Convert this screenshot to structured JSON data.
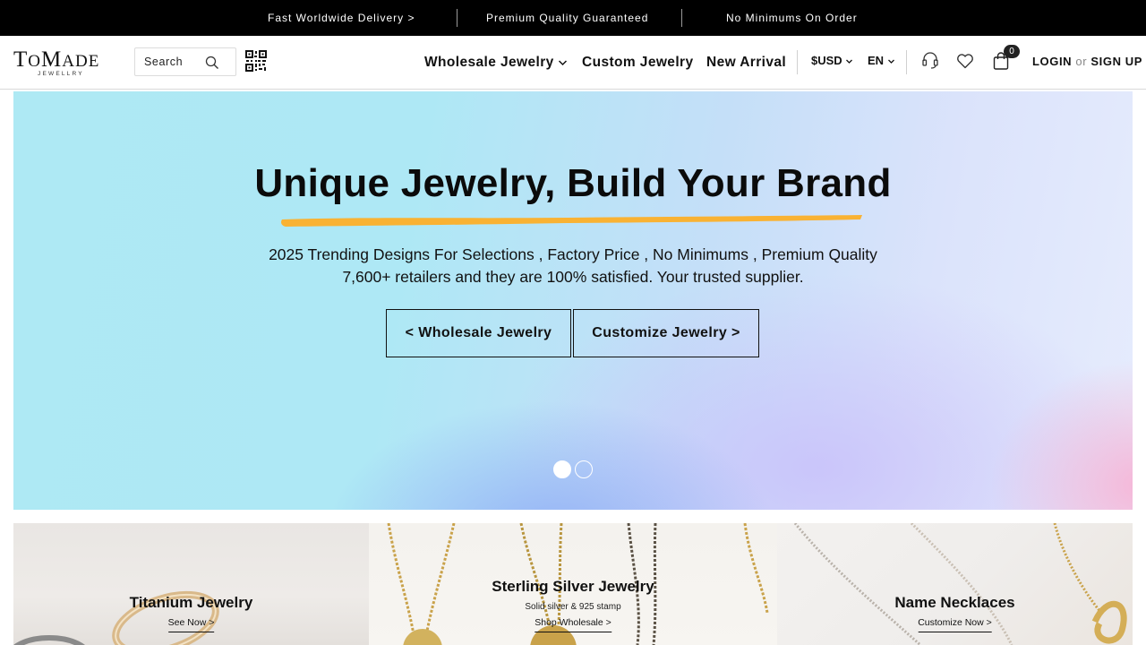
{
  "announcement": {
    "items": [
      "Fast Worldwide Delivery >",
      "Premium Quality Guaranteed",
      "No Minimums On Order"
    ]
  },
  "header": {
    "logo": {
      "word": "ToMade",
      "sub": "JEWELLRY"
    },
    "search": {
      "placeholder": "Search"
    },
    "nav": {
      "wholesale": "Wholesale Jewelry",
      "custom": "Custom Jewelry",
      "new_arrival": "New Arrival"
    },
    "currency": "$USD",
    "language": "EN",
    "cart_count": "0",
    "login": "LOGIN",
    "or": "or",
    "signup": "SIGN UP"
  },
  "hero": {
    "title": "Unique Jewelry, Build Your Brand",
    "line1": "2025 Trending Designs For Selections , Factory Price , No Minimums , Premium Quality",
    "line2": "7,600+ retailers and they are 100% satisfied. Your trusted supplier.",
    "btn_wholesale": "< Wholesale Jewelry",
    "btn_customize": "Customize Jewelry >",
    "slides": 2,
    "active_slide": 1,
    "accent_color": "#f9b233"
  },
  "tiles": [
    {
      "title": "Titanium Jewelry",
      "sub": "",
      "link": "See Now >"
    },
    {
      "title": "Sterling Silver Jewelry",
      "sub": "Solid silver & 925 stamp",
      "link": "Shop Wholesale >"
    },
    {
      "title": "Name Necklaces",
      "sub": "",
      "link": "Customize Now >"
    }
  ]
}
